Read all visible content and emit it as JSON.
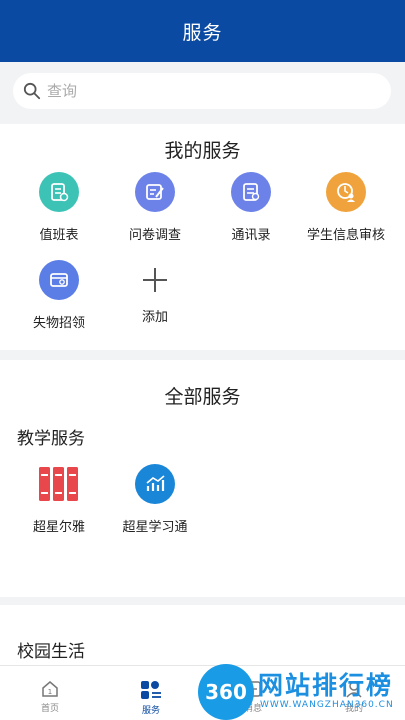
{
  "header": {
    "title": "服务"
  },
  "search": {
    "placeholder": "查询"
  },
  "my_services": {
    "title": "我的服务",
    "items": [
      {
        "label": "值班表",
        "icon": "schedule-icon",
        "color": "#3cc3b5"
      },
      {
        "label": "问卷调查",
        "icon": "survey-icon",
        "color": "#6c82e8"
      },
      {
        "label": "通讯录",
        "icon": "contacts-icon",
        "color": "#6c82e8"
      },
      {
        "label": "学生信息审核",
        "icon": "student-review-icon",
        "color": "#f0a33c"
      },
      {
        "label": "失物招领",
        "icon": "lost-found-icon",
        "color": "#5b7de6"
      },
      {
        "label": "添加",
        "icon": "plus-icon",
        "color": "#555555"
      }
    ]
  },
  "all_services": {
    "title": "全部服务",
    "groups": [
      {
        "title": "教学服务",
        "items": [
          {
            "label": "超星尔雅",
            "icon": "books-icon",
            "color": "#e8484c"
          },
          {
            "label": "超星学习通",
            "icon": "chart-icon",
            "color": "#1a86d8"
          }
        ]
      },
      {
        "title": "校园生活",
        "items": []
      }
    ]
  },
  "tabbar": {
    "items": [
      {
        "label": "首页",
        "icon": "home-icon",
        "active": false
      },
      {
        "label": "服务",
        "icon": "services-icon",
        "active": true
      },
      {
        "label": "消息",
        "icon": "message-icon",
        "active": false
      },
      {
        "label": "我的",
        "icon": "profile-icon",
        "active": false
      }
    ],
    "accent": "#0b4aa2"
  },
  "watermark": {
    "logo": "360",
    "text": "网站排行榜",
    "sub": "WWW.WANGZHAN360.CN"
  }
}
